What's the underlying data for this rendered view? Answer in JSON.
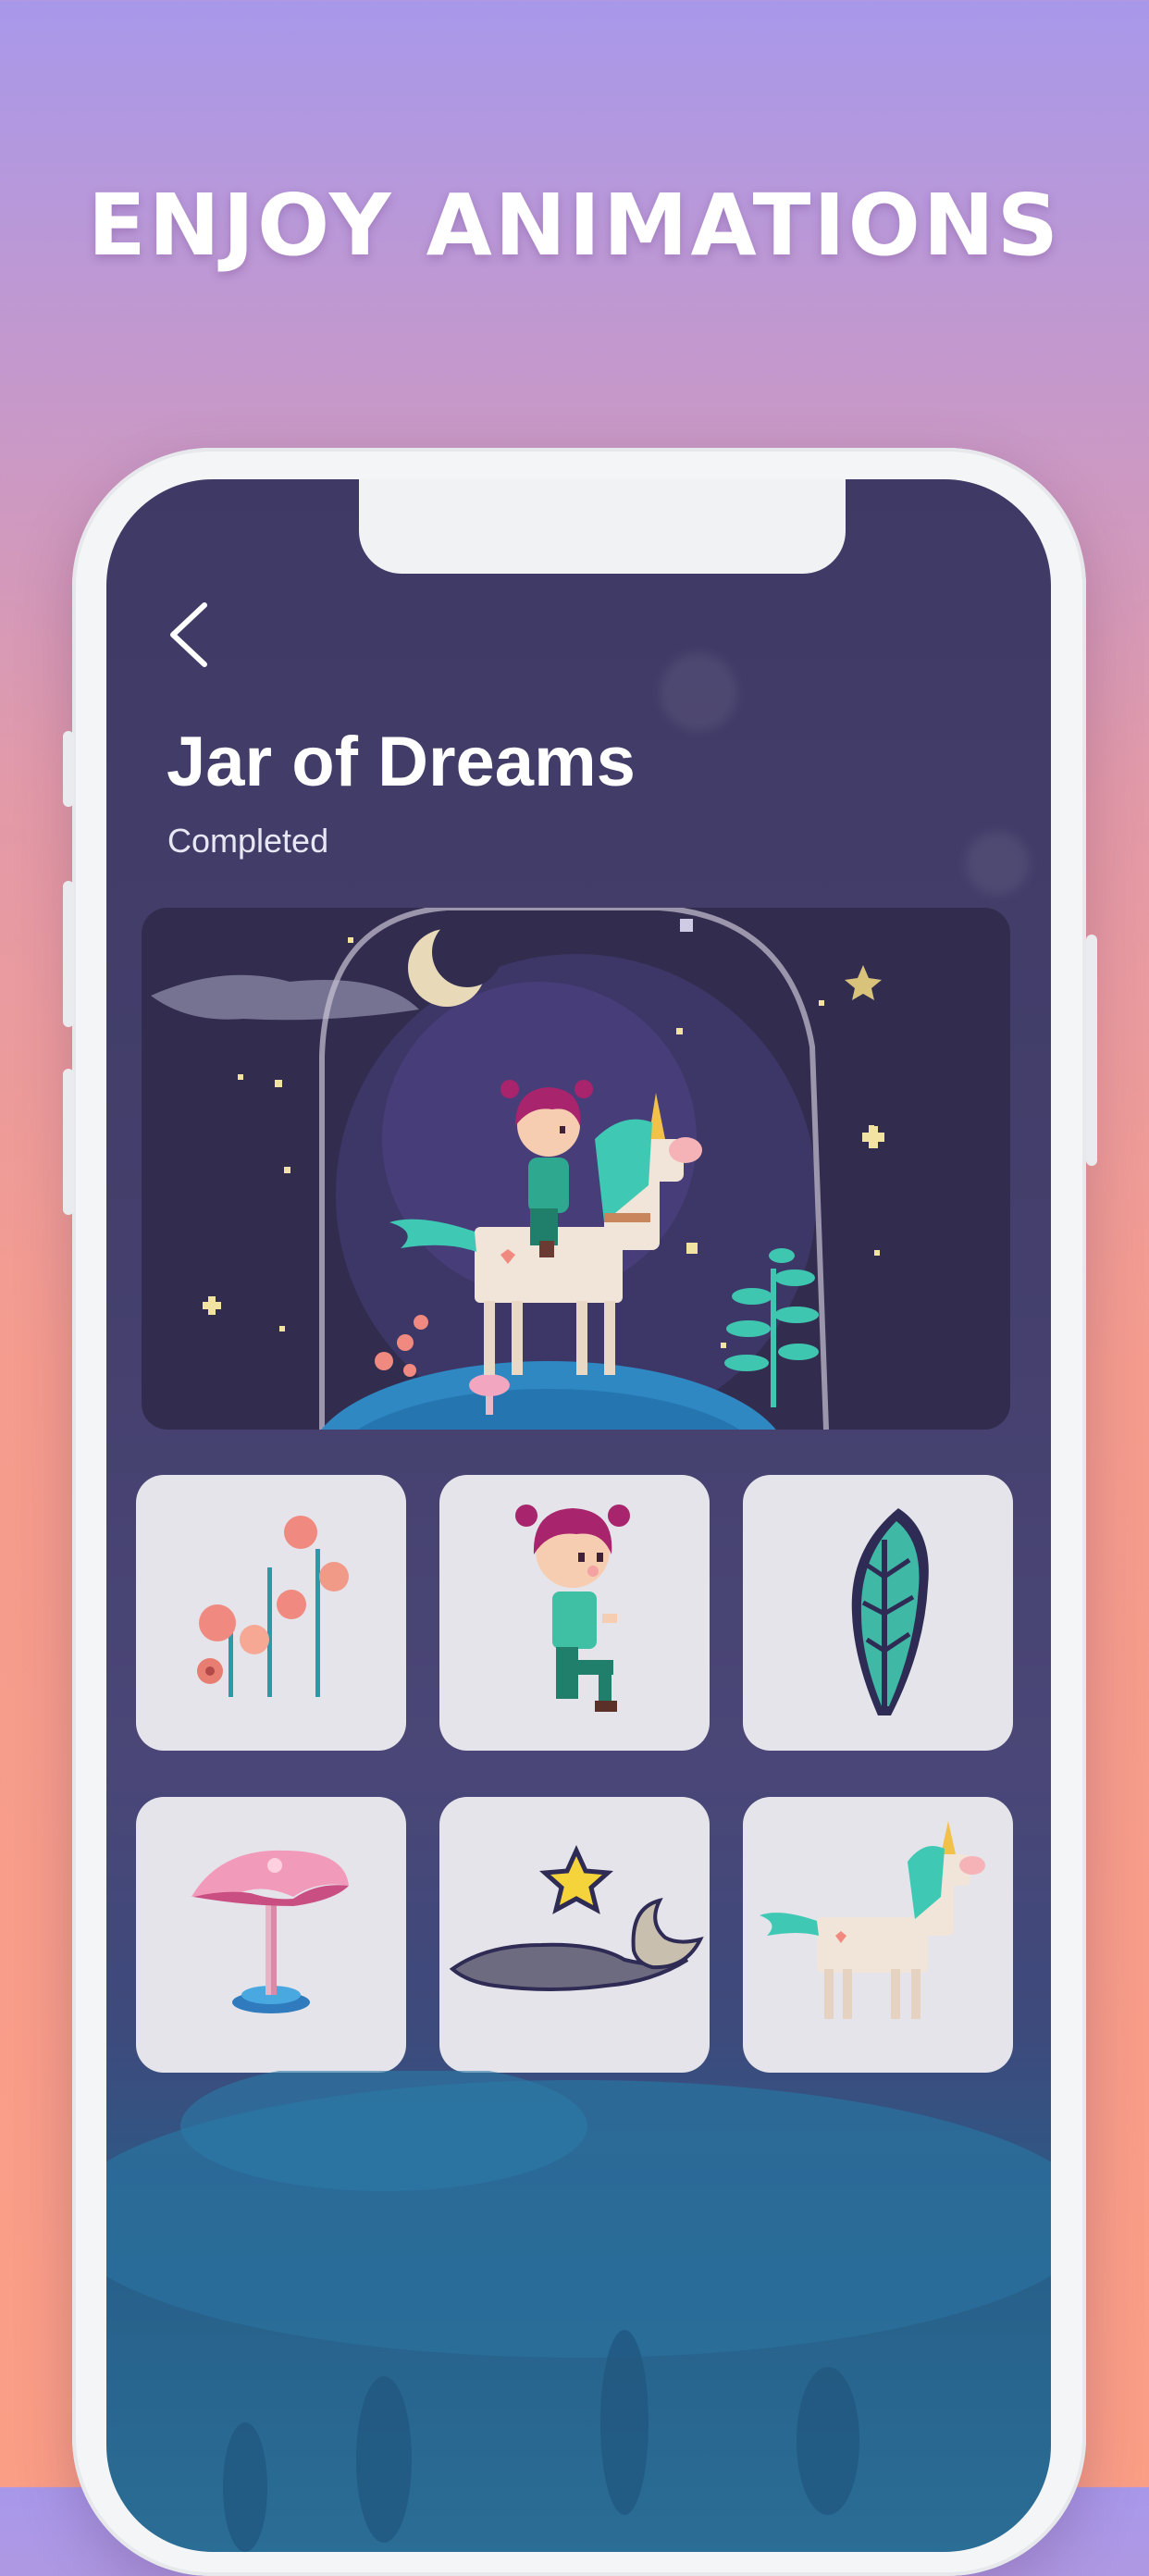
{
  "marketing": {
    "headline": "ENJOY ANIMATIONS"
  },
  "header": {
    "back_icon": "chevron-left-icon",
    "title": "Jar of Dreams",
    "status": "Completed"
  },
  "hero": {
    "artwork": "pixel-art-girl-riding-unicorn-in-jar"
  },
  "pieces": [
    {
      "icon": "pixel-flowers-icon"
    },
    {
      "icon": "pixel-girl-icon"
    },
    {
      "icon": "pixel-fern-leaf-icon"
    },
    {
      "icon": "pixel-mushroom-icon"
    },
    {
      "icon": "pixel-star-cloud-moon-icon"
    },
    {
      "icon": "pixel-unicorn-icon"
    }
  ],
  "colors": {
    "accent_pink": "#f08a80",
    "teal": "#3fc9b5",
    "night": "#3f3a65"
  }
}
